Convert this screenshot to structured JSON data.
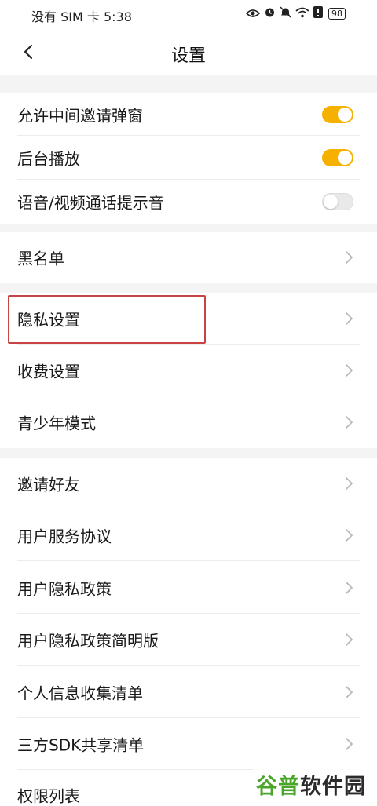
{
  "status_bar": {
    "carrier_time": "没有 SIM 卡 5:38",
    "icons": [
      "eye-icon",
      "alarm-icon",
      "mute-icon",
      "wifi-icon",
      "alert-icon"
    ],
    "battery": "98"
  },
  "nav": {
    "title": "设置",
    "back_icon": "chevron-left-icon"
  },
  "groups": {
    "toggles": [
      {
        "label": "允许中间邀请弹窗",
        "on": true
      },
      {
        "label": "后台播放",
        "on": true
      },
      {
        "label": "语音/视频通话提示音",
        "on": false
      }
    ],
    "blacklist": {
      "label": "黑名单"
    },
    "settings": [
      {
        "label": "隐私设置"
      },
      {
        "label": "收费设置"
      },
      {
        "label": "青少年模式"
      }
    ],
    "info": [
      {
        "label": "邀请好友"
      },
      {
        "label": "用户服务协议"
      },
      {
        "label": "用户隐私政策"
      },
      {
        "label": "用户隐私政策简明版"
      },
      {
        "label": "个人信息收集清单"
      },
      {
        "label": "三方SDK共享清单"
      },
      {
        "label": "权限列表"
      }
    ]
  },
  "colors": {
    "toggle_on": "#f5b000",
    "highlight": "#c84444"
  },
  "watermark": {
    "part1": "谷普",
    "part2": "软件园"
  }
}
